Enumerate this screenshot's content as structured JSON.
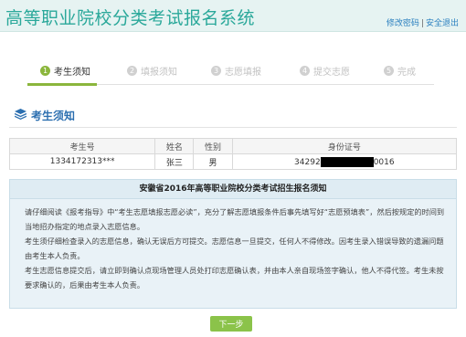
{
  "header": {
    "title": "高等职业院校分类考试报名系统",
    "change_password": "修改密码",
    "separator": "|",
    "logout": "安全退出"
  },
  "steps": [
    {
      "num": "1",
      "label": "考生须知",
      "active": true
    },
    {
      "num": "2",
      "label": "填报须知",
      "active": false
    },
    {
      "num": "3",
      "label": "志愿填报",
      "active": false
    },
    {
      "num": "4",
      "label": "提交志愿",
      "active": false
    },
    {
      "num": "5",
      "label": "完成",
      "active": false
    }
  ],
  "section": {
    "title": "考生须知",
    "icon": "stack-icon"
  },
  "table": {
    "headers": [
      "考生号",
      "姓名",
      "性别",
      "身份证号"
    ],
    "row": {
      "exam_no": "1334172313***",
      "name": "张三",
      "gender": "男",
      "id_prefix": "34292",
      "id_suffix": "0016"
    }
  },
  "notice": {
    "title": "安徽省2016年高等职业院校分类考试招生报名须知",
    "paragraphs": [
      "请仔细阅读《报考指导》中“考生志愿填报志愿必读”，充分了解志愿填报条件后事先填写好“志愿预填表”，然后按规定的时间到当地招办指定的地点录入志愿信息。",
      "考生须仔细检查录入的志愿信息，确认无误后方可提交。志愿信息一旦提交，任何人不得修改。因考生录入错误导致的遗漏问题由考生本人负责。",
      "考生志愿信息提交后，请立即到确认点现场管理人员处打印志愿确认表，并由本人亲自现场签字确认，他人不得代签。考生未按要求确认的，后果由考生本人负责。"
    ]
  },
  "actions": {
    "next_label": "下一步"
  },
  "colors": {
    "brand": "#2aa89a",
    "accent_green": "#8bb63c",
    "link_blue": "#2a7fbf",
    "notice_bg": "#e9f2f7"
  }
}
